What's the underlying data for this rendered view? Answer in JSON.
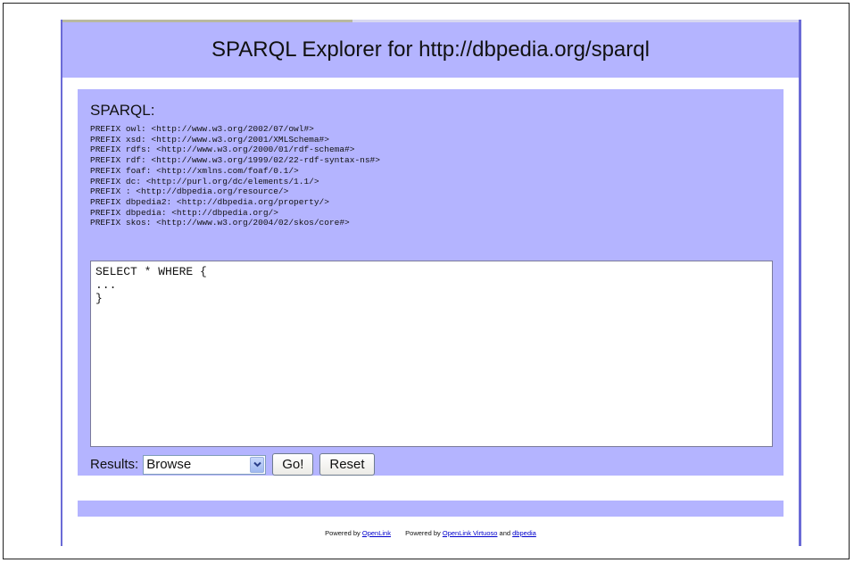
{
  "header": {
    "title": "SPARQL Explorer for http://dbpedia.org/sparql"
  },
  "query_panel": {
    "label": "SPARQL:",
    "prefixes": [
      "PREFIX owl: <http://www.w3.org/2002/07/owl#>",
      "PREFIX xsd: <http://www.w3.org/2001/XMLSchema#>",
      "PREFIX rdfs: <http://www.w3.org/2000/01/rdf-schema#>",
      "PREFIX rdf: <http://www.w3.org/1999/02/22-rdf-syntax-ns#>",
      "PREFIX foaf: <http://xmlns.com/foaf/0.1/>",
      "PREFIX dc: <http://purl.org/dc/elements/1.1/>",
      "PREFIX : <http://dbpedia.org/resource/>",
      "PREFIX dbpedia2: <http://dbpedia.org/property/>",
      "PREFIX dbpedia: <http://dbpedia.org/>",
      "PREFIX skos: <http://www.w3.org/2004/02/skos/core#>"
    ],
    "query_text": "SELECT * WHERE {\n...\n}"
  },
  "controls": {
    "results_label": "Results:",
    "results_selected": "Browse",
    "go_label": "Go!",
    "reset_label": "Reset"
  },
  "footer": {
    "powered1_prefix": "Powered by",
    "powered1_link": "OpenLink",
    "powered2_prefix": "Powered by",
    "powered2_link": "OpenLink Virtuoso",
    "and_text": "and",
    "dbpedia_link": "dbpedia"
  },
  "colors": {
    "panel_background": "#b4b4ff",
    "border_accent": "#6b6bd6",
    "link": "#0000cc"
  },
  "icons": {
    "dropdown": "chevron-down-icon"
  }
}
